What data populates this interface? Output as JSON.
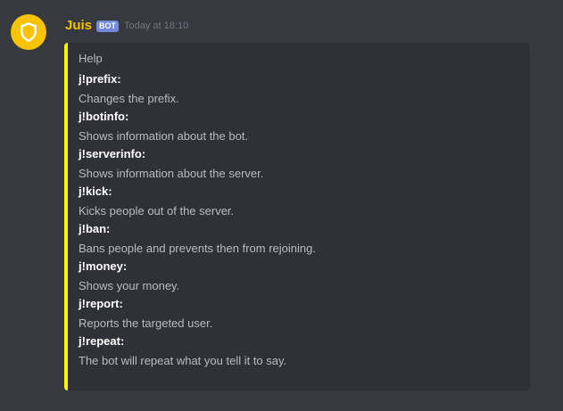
{
  "author": {
    "name": "Juis",
    "tag": "BOT",
    "timestamp": "Today at 18:10",
    "avatar_icon": "shield-icon",
    "name_color": "#f8c300"
  },
  "embed": {
    "accent_color": "#f8f800",
    "title": "Help",
    "fields": [
      {
        "name": "j!prefix:",
        "value": "Changes the prefix."
      },
      {
        "name": "j!botinfo:",
        "value": "Shows information about the bot."
      },
      {
        "name": "j!serverinfo:",
        "value": "Shows information about the server."
      },
      {
        "name": "j!kick:",
        "value": "Kicks people out of the server."
      },
      {
        "name": "j!ban:",
        "value": "Bans people and prevents then from rejoining."
      },
      {
        "name": "j!money:",
        "value": "Shows your money."
      },
      {
        "name": "j!report:",
        "value": "Reports the targeted user."
      },
      {
        "name": "j!repeat:",
        "value": "The bot will repeat what you tell it to say."
      }
    ]
  }
}
